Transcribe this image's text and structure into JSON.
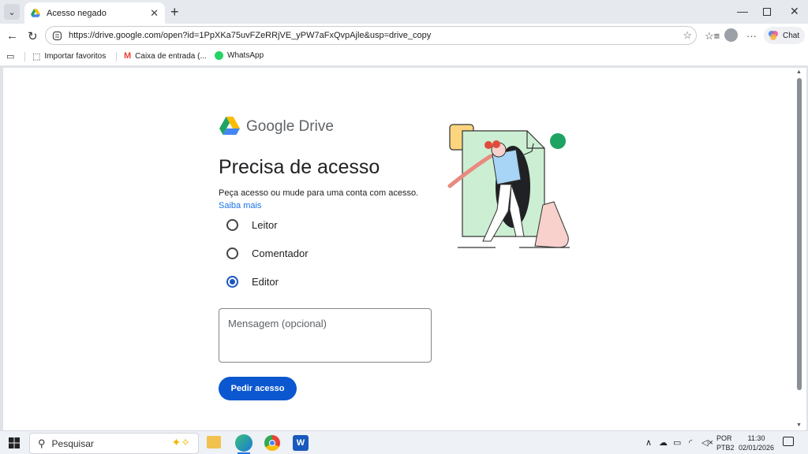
{
  "browser": {
    "tab_title": "Acesso negado",
    "tab_close": "✕",
    "new_tab": "+",
    "url": "https://drive.google.com/open?id=1PpXKa75uvFZeRRjVE_yPW7aFxQvpAjle&usp=drive_copy",
    "chat_label": "Chat",
    "bookmarks": [
      {
        "label": "Importar favoritos"
      },
      {
        "label": "Caixa de entrada (..."
      },
      {
        "label": "WhatsApp"
      }
    ]
  },
  "page": {
    "logo_text": "Google Drive",
    "heading": "Precisa de acesso",
    "description": "Peça acesso ou mude para uma conta com acesso.",
    "learn_more": "Saiba mais",
    "roles": [
      {
        "label": "Leitor",
        "selected": false
      },
      {
        "label": "Comentador",
        "selected": false
      },
      {
        "label": "Editor",
        "selected": true
      }
    ],
    "message_placeholder": "Mensagem (opcional)",
    "submit_label": "Pedir acesso"
  },
  "taskbar": {
    "search_placeholder": "Pesquisar",
    "lang_line1": "POR",
    "lang_line2": "PTB2",
    "time": "11:30",
    "date": "02/01/2026"
  }
}
